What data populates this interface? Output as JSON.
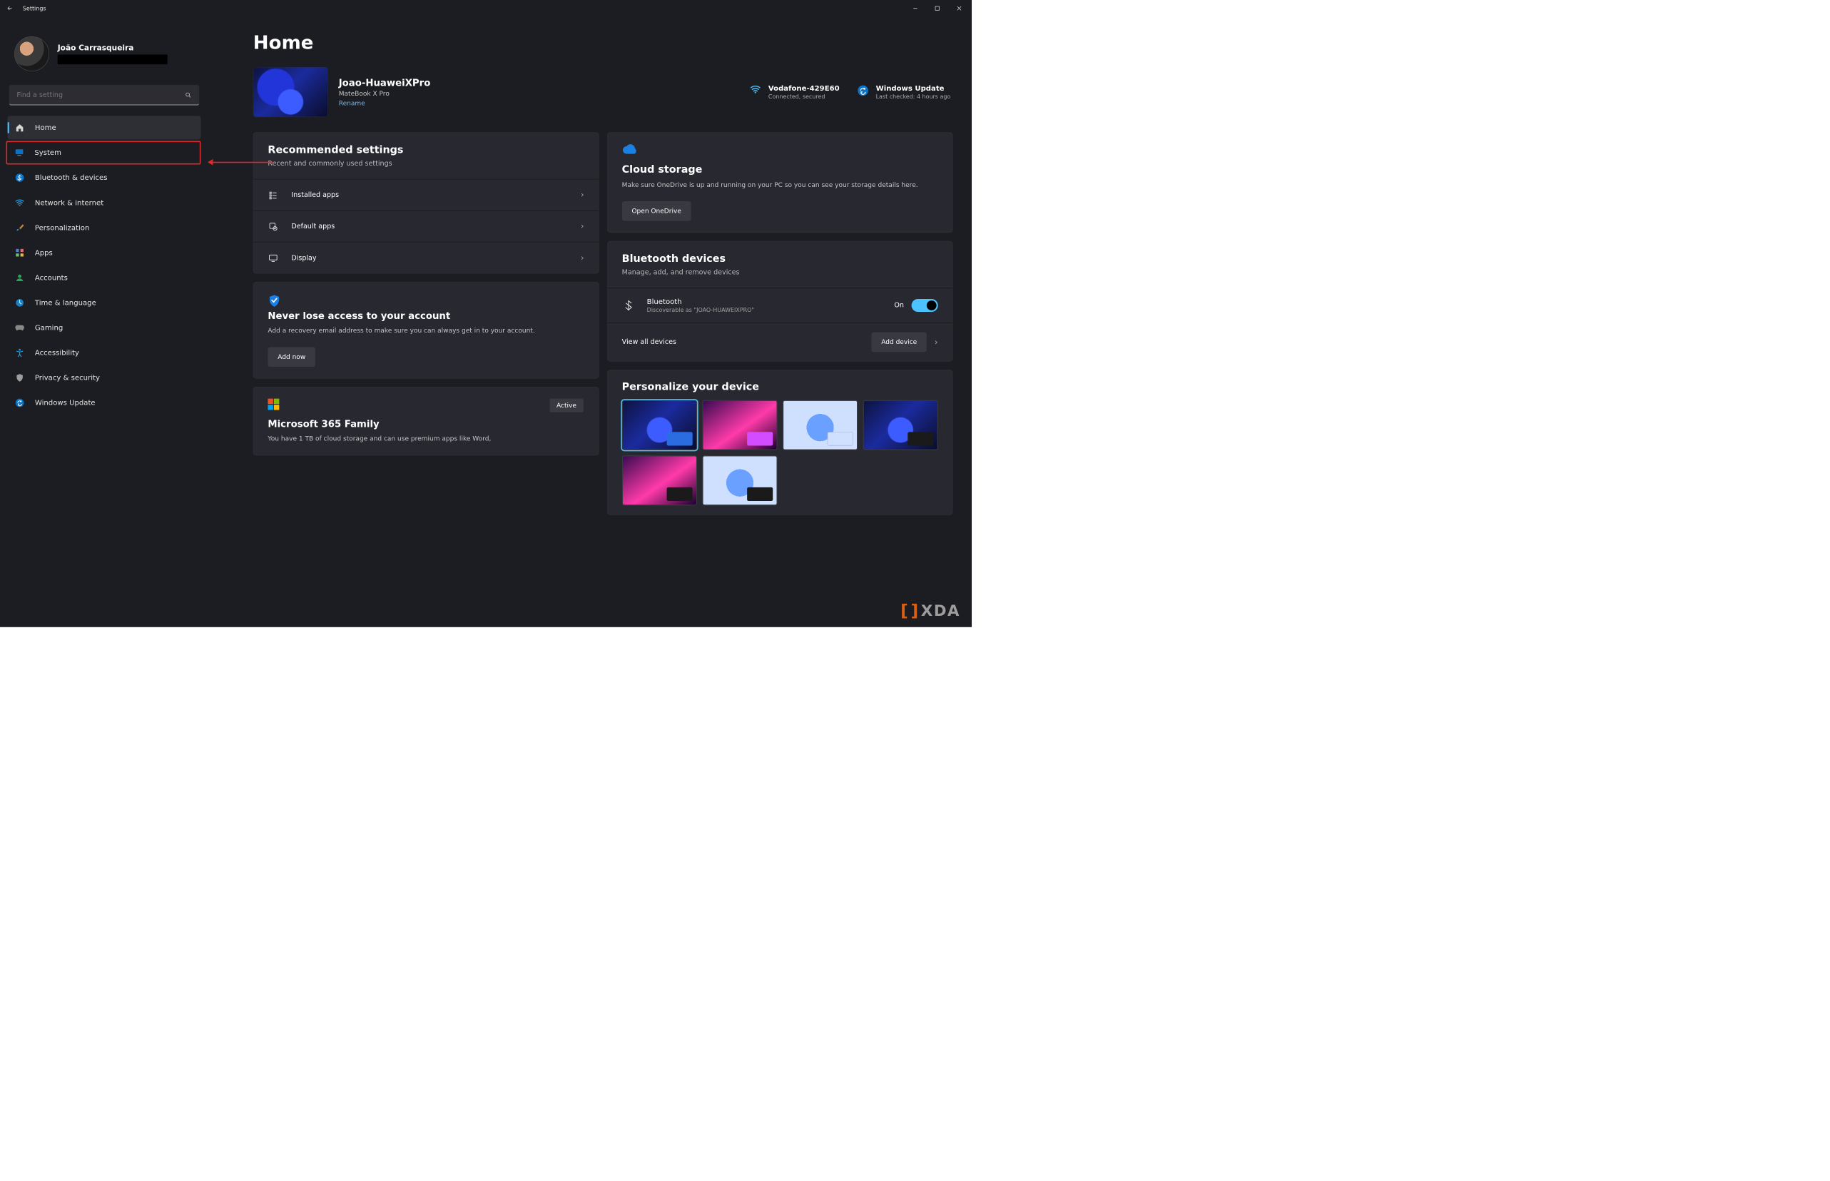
{
  "titlebar": {
    "title": "Settings"
  },
  "profile": {
    "name": "João Carrasqueira"
  },
  "search": {
    "placeholder": "Find a setting"
  },
  "nav": [
    {
      "label": "Home"
    },
    {
      "label": "System"
    },
    {
      "label": "Bluetooth & devices"
    },
    {
      "label": "Network & internet"
    },
    {
      "label": "Personalization"
    },
    {
      "label": "Apps"
    },
    {
      "label": "Accounts"
    },
    {
      "label": "Time & language"
    },
    {
      "label": "Gaming"
    },
    {
      "label": "Accessibility"
    },
    {
      "label": "Privacy & security"
    },
    {
      "label": "Windows Update"
    }
  ],
  "page": {
    "title": "Home"
  },
  "pc": {
    "name": "Joao-HuaweiXPro",
    "model": "MateBook X Pro",
    "rename": "Rename"
  },
  "status": {
    "wifi": {
      "name": "Vodafone-429E60",
      "sub": "Connected, secured"
    },
    "update": {
      "name": "Windows Update",
      "sub": "Last checked: 4 hours ago"
    }
  },
  "recommended": {
    "title": "Recommended settings",
    "sub": "Recent and commonly used settings",
    "items": [
      {
        "label": "Installed apps"
      },
      {
        "label": "Default apps"
      },
      {
        "label": "Display"
      }
    ]
  },
  "account": {
    "title": "Never lose access to your account",
    "body": "Add a recovery email address to make sure you can always get in to your account.",
    "button": "Add now"
  },
  "m365": {
    "badge": "Active",
    "title": "Microsoft 365 Family",
    "body": "You have 1 TB of cloud storage and can use premium apps like Word,"
  },
  "cloud": {
    "title": "Cloud storage",
    "body": "Make sure OneDrive is up and running on your PC so you can see your storage details here.",
    "button": "Open OneDrive"
  },
  "bluetooth": {
    "title": "Bluetooth devices",
    "sub": "Manage, add, and remove devices",
    "item": {
      "label": "Bluetooth",
      "desc": "Discoverable as \"JOAO-HUAWEIXPRO\"",
      "state": "On"
    },
    "viewall": "View all devices",
    "add": "Add device"
  },
  "personalize": {
    "title": "Personalize your device"
  },
  "watermark": "XDA"
}
